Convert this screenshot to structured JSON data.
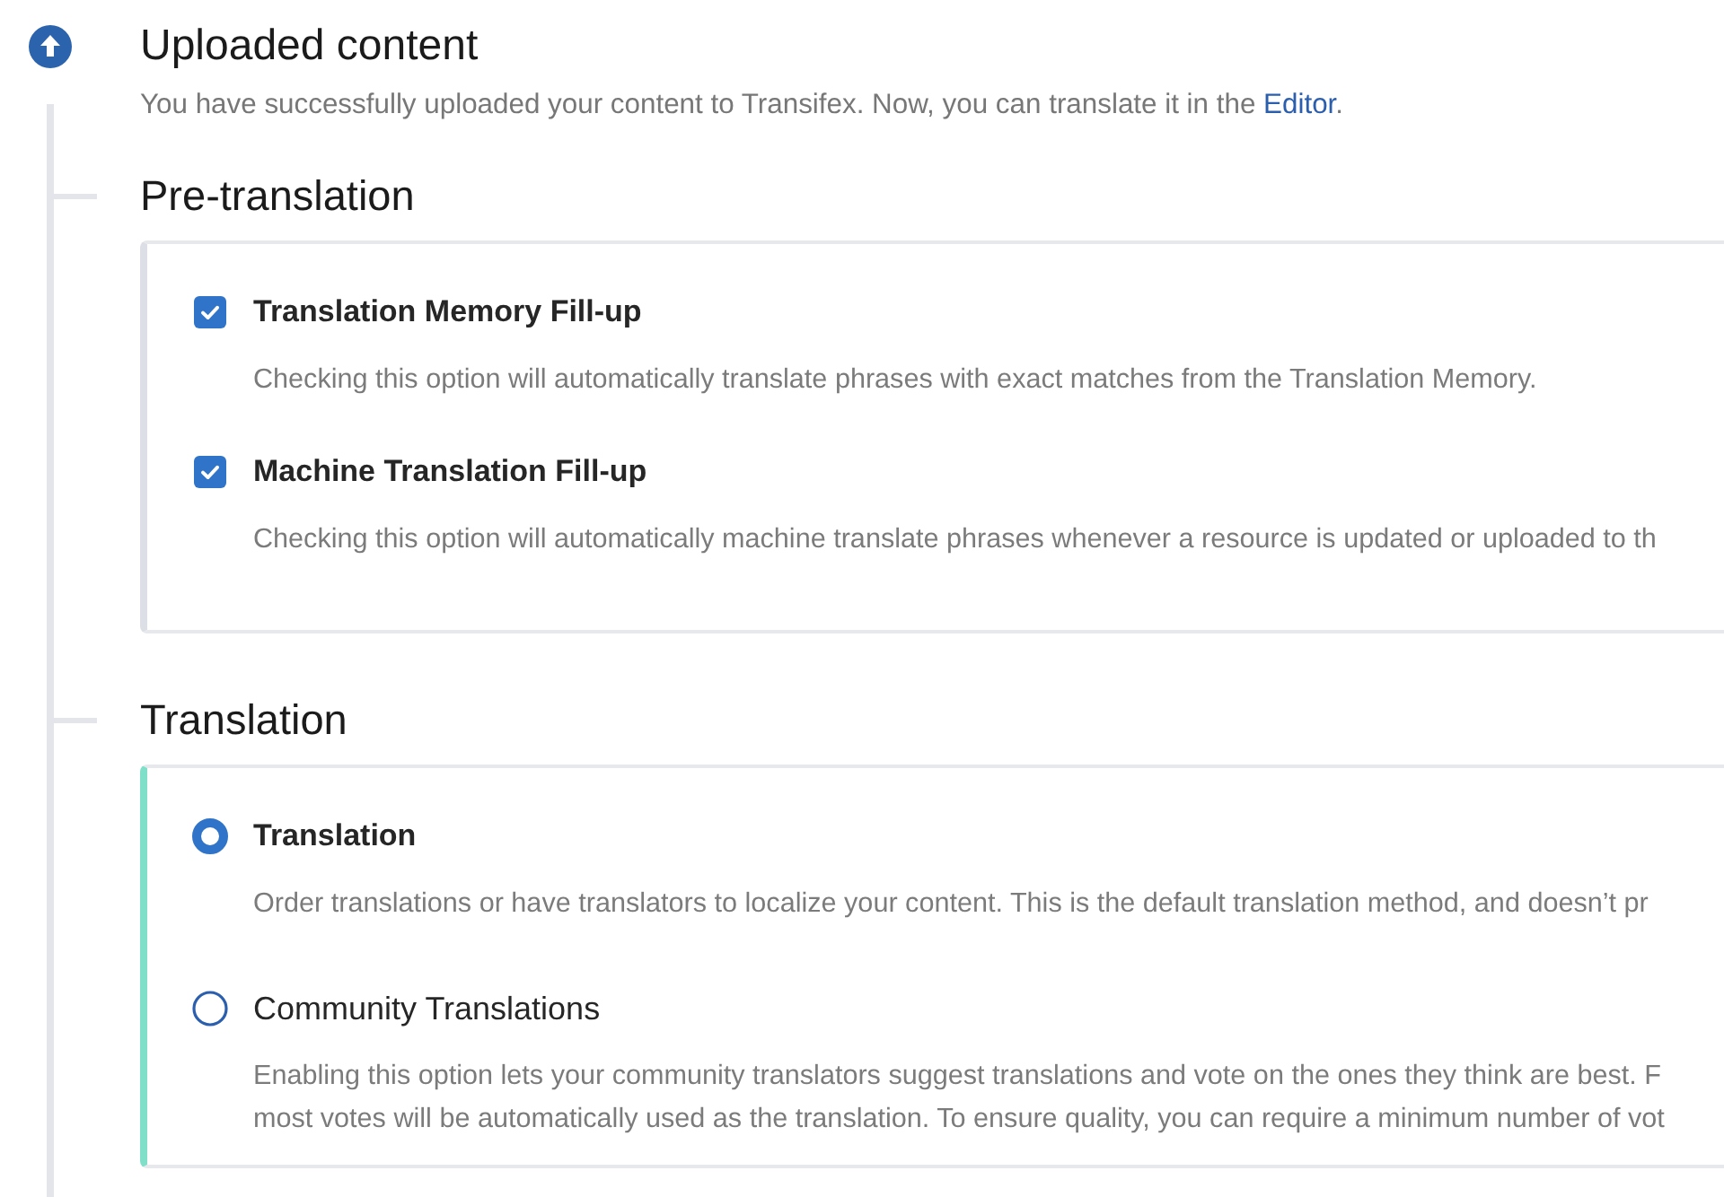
{
  "header": {
    "title": "Uploaded content",
    "message": "You have successfully uploaded your content to Transifex. Now, you can translate it in the ",
    "link": "Editor",
    "message_end": "."
  },
  "sections": [
    {
      "title": "Pre-translation",
      "color": "#dcdfe5",
      "kind": "checkbox",
      "options": [
        {
          "label": "Translation Memory Fill-up",
          "checked": true,
          "description_lines": [
            "Checking this option will automatically translate phrases with exact matches from the Translation Memory."
          ]
        },
        {
          "label": "Machine Translation Fill-up",
          "checked": true,
          "description_lines": [
            "Checking this option will automatically machine translate phrases whenever a resource is updated or uploaded to th"
          ]
        }
      ]
    },
    {
      "title": "Translation",
      "color": "#80dfc9",
      "kind": "radio",
      "options": [
        {
          "label": "Translation",
          "selected": true,
          "description_lines": [
            "Order translations or have translators to localize your content. This is the default translation method, and doesn’t pr"
          ]
        },
        {
          "label": "Community Translations",
          "selected": false,
          "description_lines": [
            "Enabling this option lets your community translators suggest translations and vote on the ones they think are best. F",
            "most votes will be automatically used as the translation. To ensure quality, you can require a minimum number of vot"
          ]
        }
      ]
    }
  ]
}
